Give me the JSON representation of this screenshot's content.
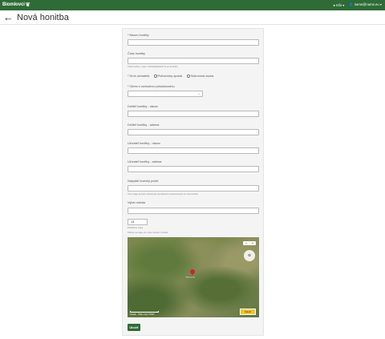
{
  "topbar": {
    "brand": "Biomlovci",
    "brand_icon": "deer-icon",
    "info_label": "Info",
    "user_email": "name@name.eu"
  },
  "page": {
    "title": "Nová honitba",
    "back_icon": "arrow-left-icon"
  },
  "form": {
    "name_label": "* Názov honitby",
    "number_label": "Číslo honitby",
    "number_help": "Číslo honitby v tvare: COHHHHHHHH? (4 až 10 číslic)",
    "owner_label": "* Druh užívateľa",
    "owner_options": [
      "Poľovnícky spolok",
      "Súkromná osoba"
    ],
    "region_label": "* Okres s rozhodnou príslušnosťou",
    "region_value": "",
    "holder_name_label": "Držiteľ honitby - názov",
    "holder_address_label": "Držiteľ honitby - adresa",
    "user_name_label": "Užívateľ honitby - názov",
    "user_address_label": "Užívateľ honitby - adresa",
    "hunt_number_label": "Najvyšší lovecký počet",
    "hunt_number_help": "Tieto údaje sa budú zobrazovať na faktúrach vystavovaných pre túto honitbu",
    "place_label": "Výber miesta",
    "zoom_value": "13",
    "zoom_label": "Priblíženie mapy",
    "map_help": "Kliknite na mapu pre výber miesta v honitbe",
    "save_label": "Uložiť"
  },
  "map": {
    "zoom_in": "+",
    "zoom_out": "−",
    "compass": "⊕",
    "place_label": "Hrinová",
    "attribution": "Google · Údaje mapy ©2024",
    "map_type_label": "Satelit"
  }
}
